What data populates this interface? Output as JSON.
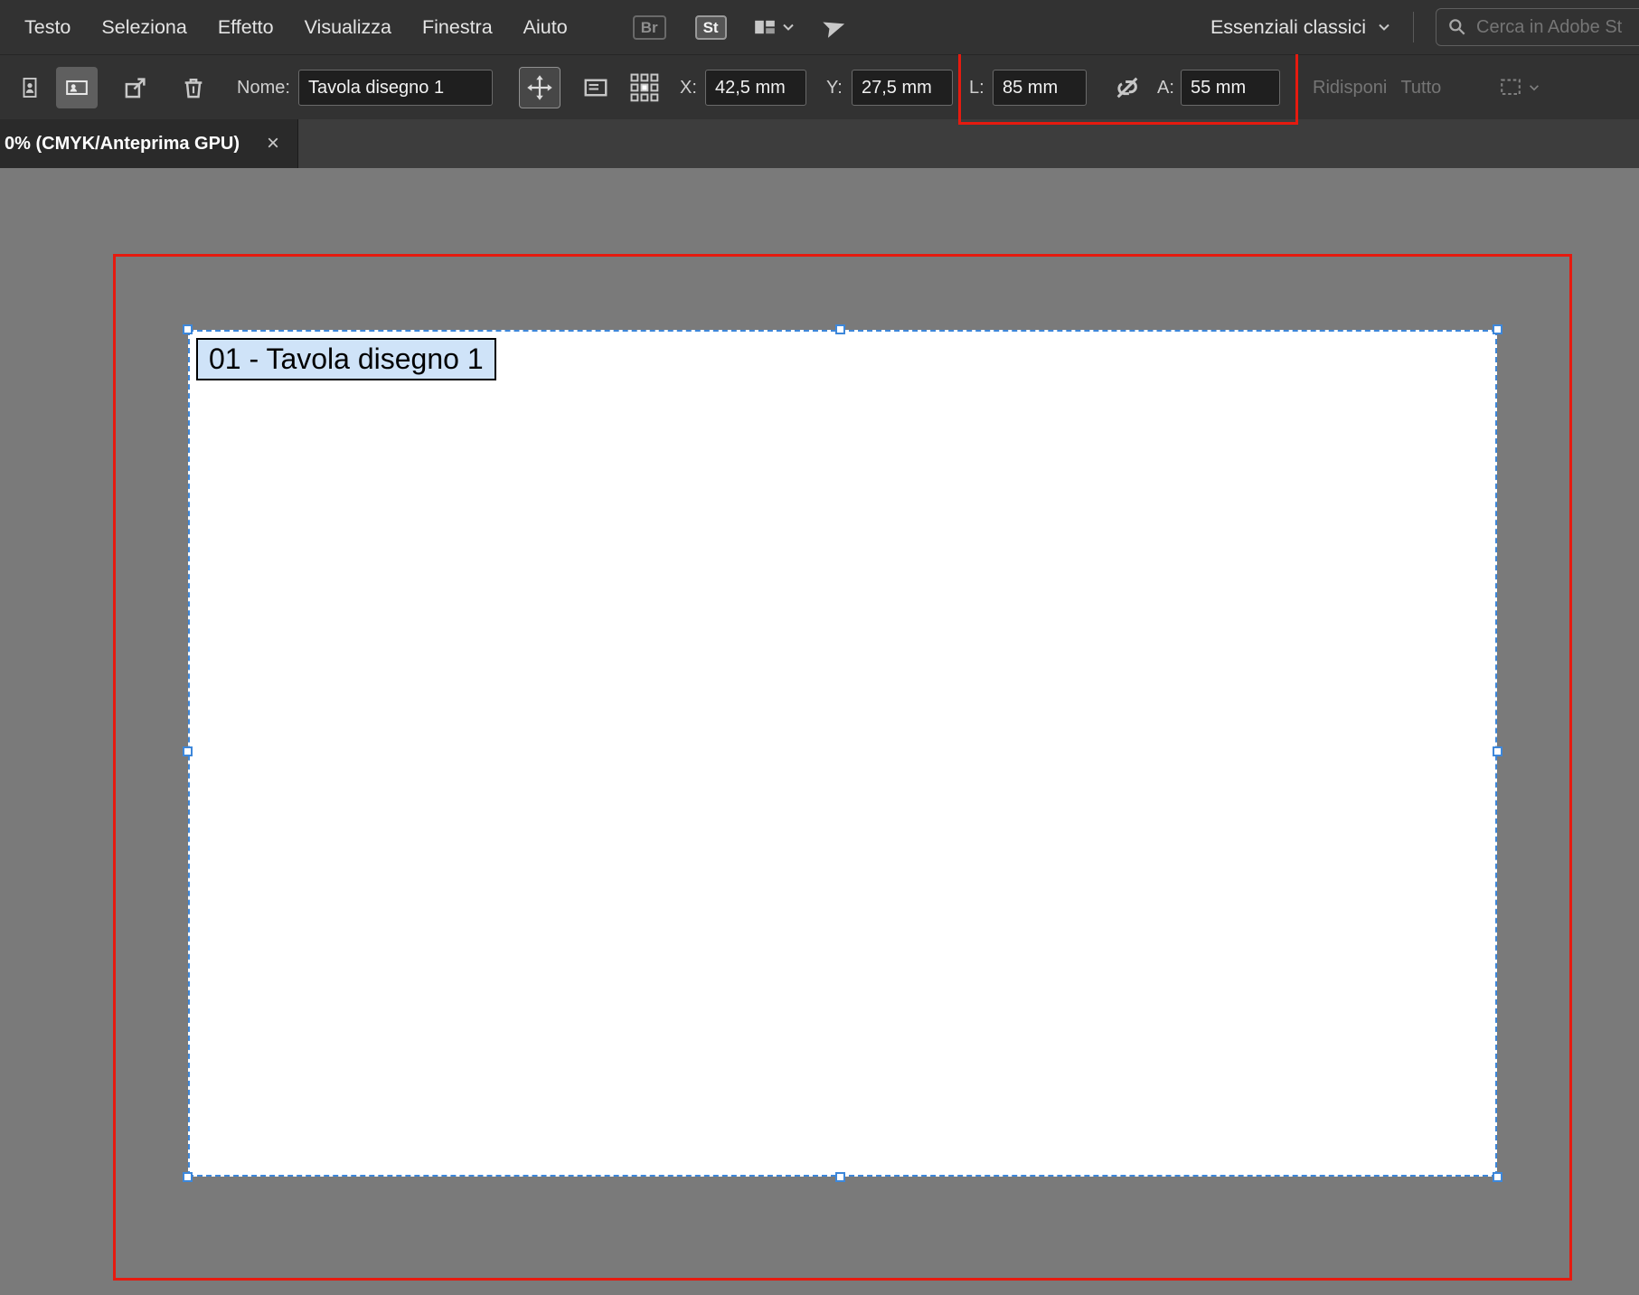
{
  "colors": {
    "annotation_red": "#e61a0f",
    "selection_blue": "#3d87da",
    "tag_bg": "#cfe3f8"
  },
  "menubar": {
    "items": [
      {
        "label": "Testo"
      },
      {
        "label": "Seleziona"
      },
      {
        "label": "Effetto"
      },
      {
        "label": "Visualizza"
      },
      {
        "label": "Finestra"
      },
      {
        "label": "Aiuto"
      }
    ],
    "bridge_badge": "Br",
    "stock_badge": "St",
    "workspace_label": "Essenziali classici",
    "search_placeholder": "Cerca in Adobe St"
  },
  "control_bar": {
    "name_label": "Nome:",
    "name_value": "Tavola disegno 1",
    "x_label": "X:",
    "x_value": "42,5 mm",
    "y_label": "Y:",
    "y_value": "27,5 mm",
    "width_label": "L:",
    "width_value": "85 mm",
    "height_label": "A:",
    "height_value": "55 mm",
    "rearrange_all_label": "Ridisponi Tutto"
  },
  "document_tab": {
    "title": "0% (CMYK/Anteprima GPU)",
    "close_label": "×"
  },
  "artboard": {
    "name_tag": "01 - Tavola disegno 1"
  }
}
